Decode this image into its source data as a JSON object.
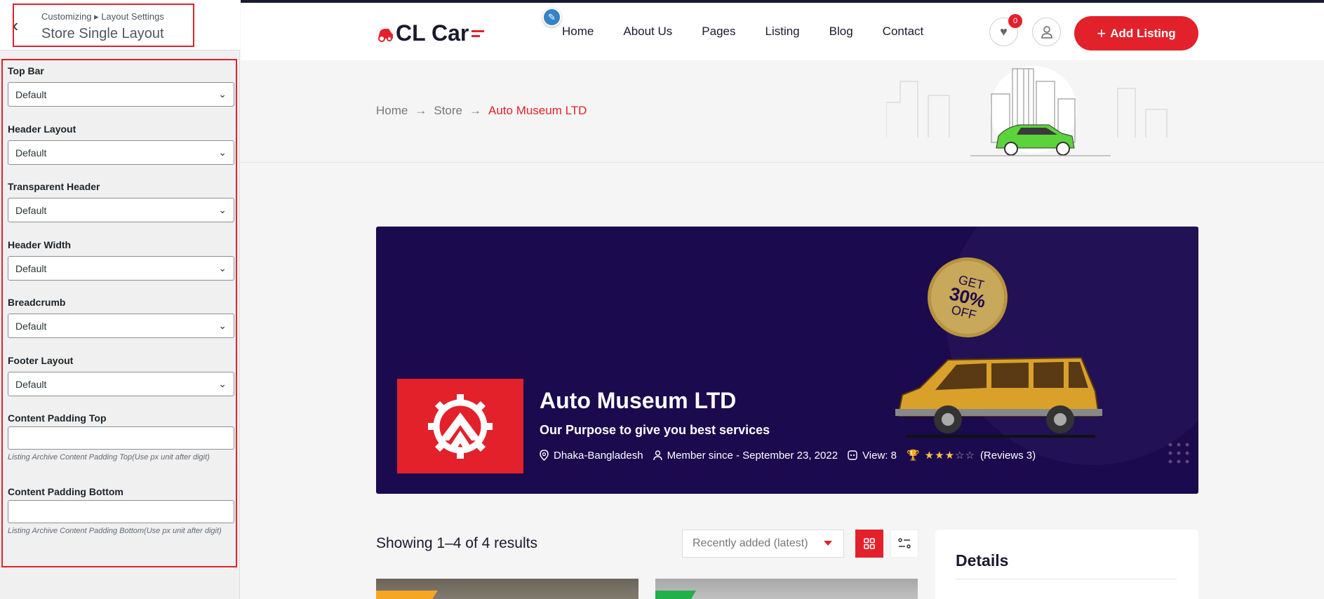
{
  "sidebar": {
    "crumb": "Customizing ▸ Layout Settings",
    "title": "Store Single Layout",
    "fields": [
      {
        "label": "Top Bar",
        "value": "Default"
      },
      {
        "label": "Header Layout",
        "value": "Default"
      },
      {
        "label": "Transparent Header",
        "value": "Default"
      },
      {
        "label": "Header Width",
        "value": "Default"
      },
      {
        "label": "Breadcrumb",
        "value": "Default"
      },
      {
        "label": "Footer Layout",
        "value": "Default"
      }
    ],
    "padding_top": {
      "label": "Content Padding Top",
      "value": "",
      "hint": "Listing Archive Content Padding Top(Use px unit after digit)"
    },
    "padding_bottom": {
      "label": "Content Padding Bottom",
      "value": "",
      "hint": "Listing Archive Content Padding Bottom(Use px unit after digit)"
    }
  },
  "site": {
    "logo_text": "CL Car",
    "nav": [
      "Home",
      "About Us",
      "Pages",
      "Listing",
      "Blog",
      "Contact"
    ],
    "fav_count": "0",
    "add_listing": "Add Listing",
    "breadcrumb": {
      "home": "Home",
      "store": "Store",
      "current": "Auto Museum LTD"
    },
    "banner": {
      "name": "Auto Museum LTD",
      "tagline": "Our Purpose to give you best services",
      "location": "Dhaka-Bangladesh",
      "member_since": "Member since - September 23, 2022",
      "views": "View: 8",
      "rating": 3,
      "rating_max": 5,
      "reviews": "(Reviews 3)",
      "promo": {
        "line1": "GET",
        "line2": "30%",
        "line3": "OFF"
      }
    },
    "results": "Showing 1–4 of 4 results",
    "sort": "Recently added (latest)",
    "details_title": "Details"
  },
  "colors": {
    "accent": "#e3212b",
    "banner_bg": "#1b0a4e",
    "edit_pin": "#3582c4"
  },
  "icons": [
    "back-chevron-icon",
    "pencil-icon",
    "heart-icon",
    "user-icon",
    "plus-icon",
    "arrow-right-icon",
    "map-pin-icon",
    "user-icon",
    "eye-icon",
    "trophy-icon",
    "star-icon",
    "grid-icon",
    "list-icon",
    "dots-grid-icon",
    "gear-logo-icon"
  ]
}
